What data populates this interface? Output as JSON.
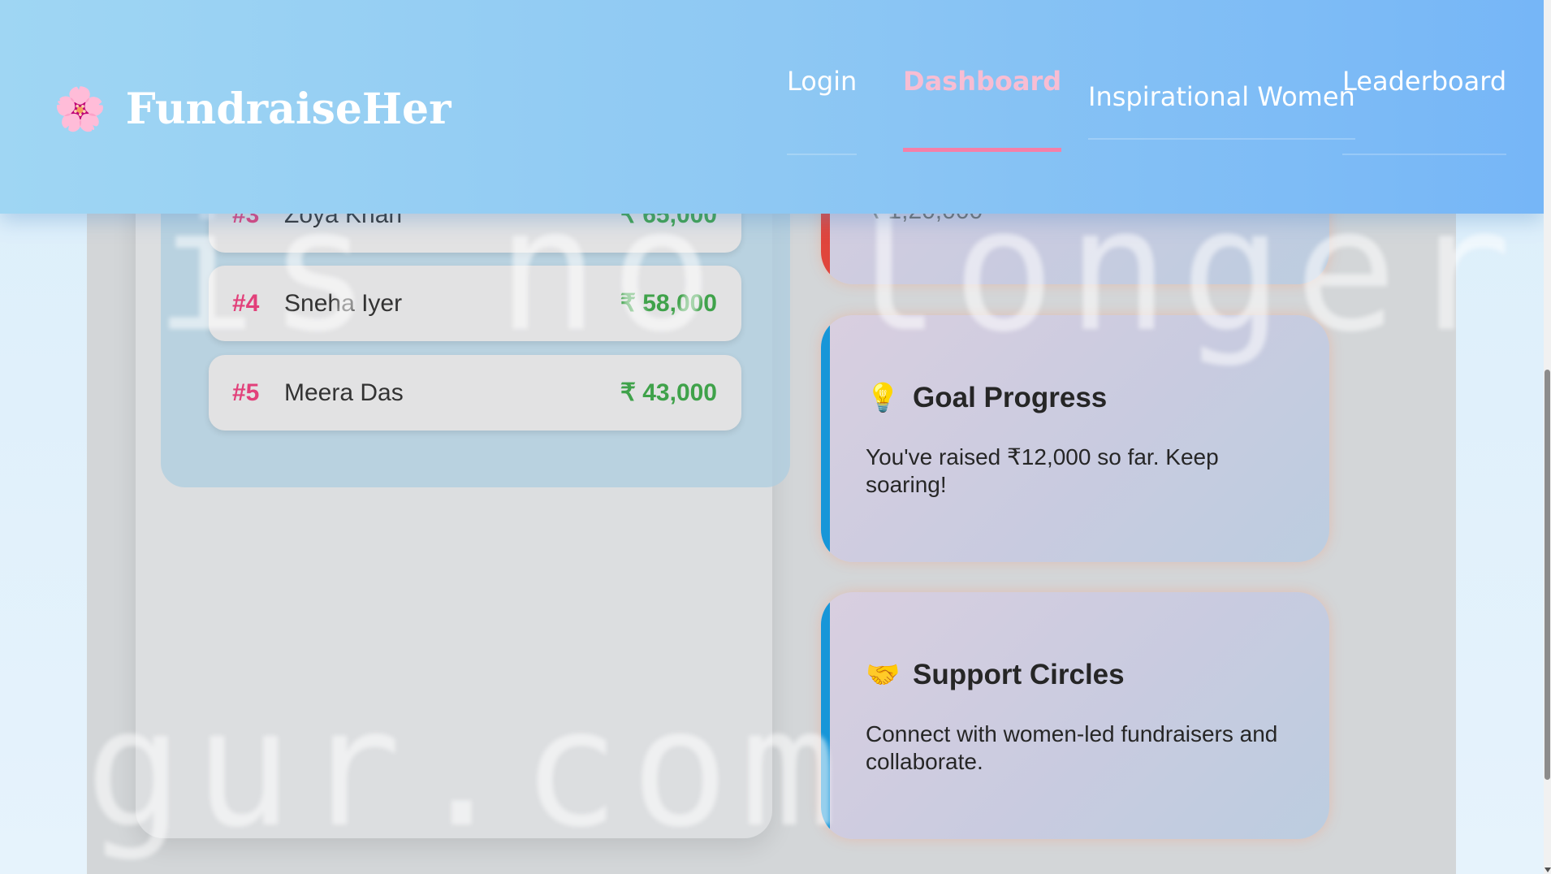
{
  "header": {
    "brand_icon": "🌸",
    "brand_name": "FundraiseHer",
    "nav": {
      "login": "Login",
      "dashboard": "Dashboard",
      "inspirational_women": "Inspirational Women",
      "leaderboard": "Leaderboard"
    },
    "active_nav": "Dashboard"
  },
  "leaderboard": {
    "rows": [
      {
        "rank": "#3",
        "name": "Zoya Khan",
        "amount": "₹ 65,000"
      },
      {
        "rank": "#4",
        "name": "Sneha Iyer",
        "amount": "₹ 58,000"
      },
      {
        "rank": "#5",
        "name": "Meera Das",
        "amount": "₹ 43,000"
      }
    ]
  },
  "cards": {
    "partial_amount": "₹ 1,20,000",
    "goal_progress": {
      "icon": "💡",
      "title": "Goal Progress",
      "text": "You've raised ₹12,000 so far. Keep soaring!"
    },
    "support_circles": {
      "icon": "🤝",
      "title": "Support Circles",
      "text": "Connect with women-led fundraisers and collaborate."
    }
  },
  "watermark": {
    "top": "is no longer",
    "bottom": "gur.com"
  },
  "colors": {
    "accent_pink": "#f57fa7",
    "rank_pink": "#e2407a",
    "amount_green": "#3fa24a",
    "card_border_blue": "#1796d8",
    "card_border_red": "#e0453c"
  }
}
